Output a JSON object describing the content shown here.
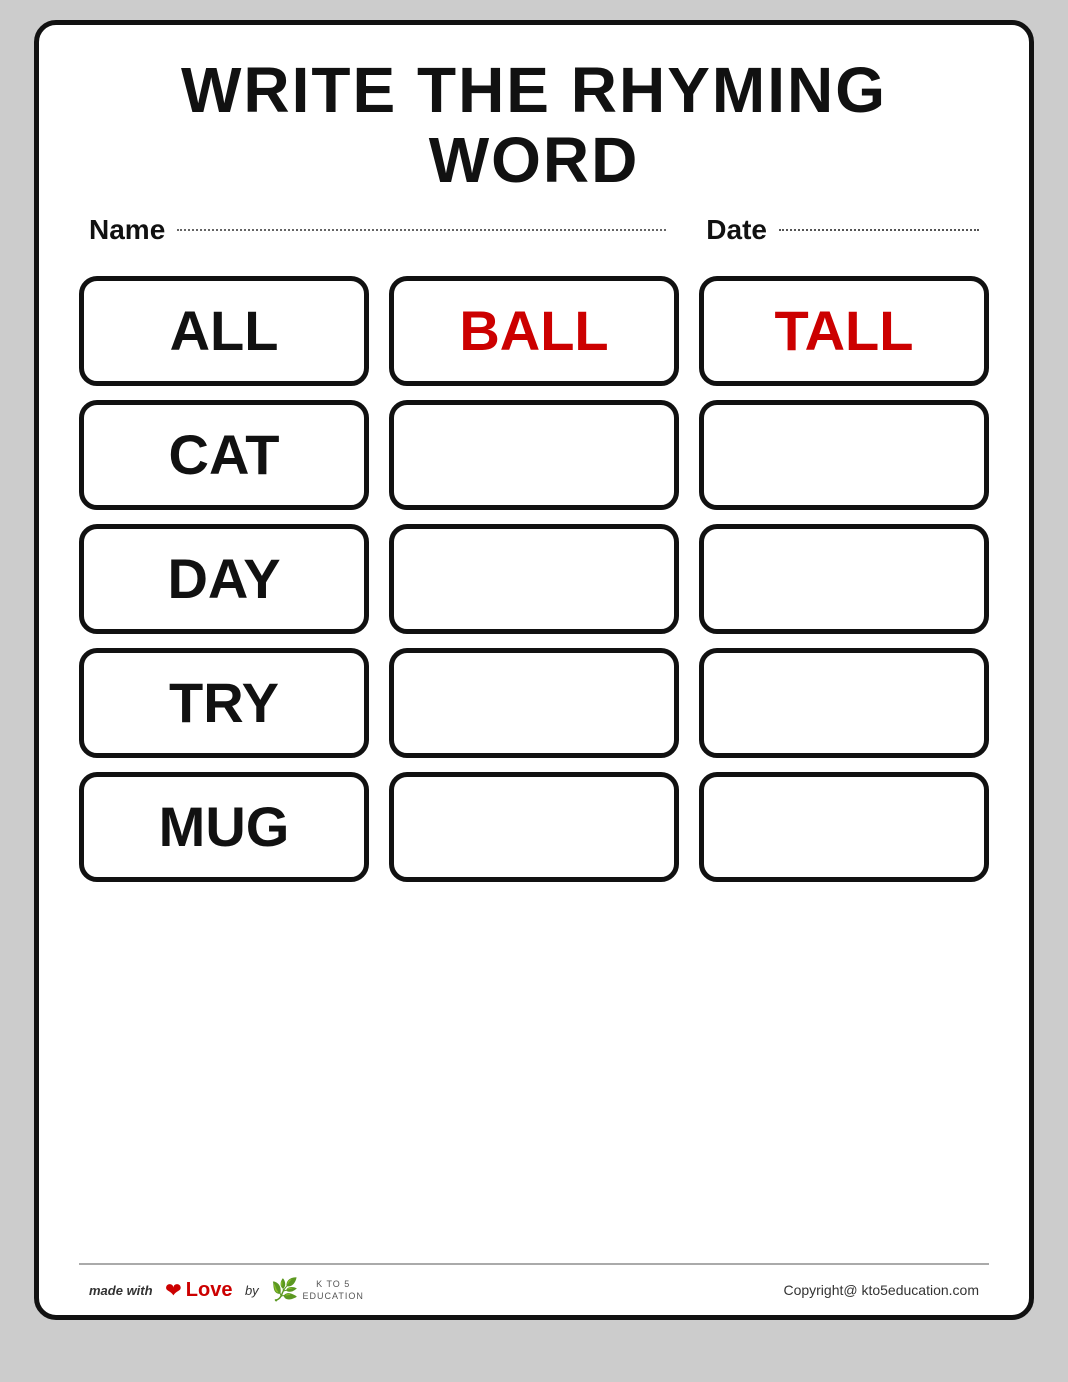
{
  "title": {
    "line1": "WRITE THE RHYMING",
    "line2": "WORD"
  },
  "fields": {
    "name_label": "Name",
    "date_label": "Date"
  },
  "rows": [
    {
      "col1": {
        "text": "ALL",
        "color": "black",
        "empty": false
      },
      "col2": {
        "text": "BALL",
        "color": "red",
        "empty": false
      },
      "col3": {
        "text": "TALL",
        "color": "red",
        "empty": false
      }
    },
    {
      "col1": {
        "text": "CAT",
        "color": "black",
        "empty": false
      },
      "col2": {
        "text": "",
        "color": "black",
        "empty": true
      },
      "col3": {
        "text": "",
        "color": "black",
        "empty": true
      }
    },
    {
      "col1": {
        "text": "DAY",
        "color": "black",
        "empty": false
      },
      "col2": {
        "text": "",
        "color": "black",
        "empty": true
      },
      "col3": {
        "text": "",
        "color": "black",
        "empty": true
      }
    },
    {
      "col1": {
        "text": "TRY",
        "color": "black",
        "empty": false
      },
      "col2": {
        "text": "",
        "color": "black",
        "empty": true
      },
      "col3": {
        "text": "",
        "color": "black",
        "empty": true
      }
    },
    {
      "col1": {
        "text": "MUG",
        "color": "black",
        "empty": false
      },
      "col2": {
        "text": "",
        "color": "black",
        "empty": true
      },
      "col3": {
        "text": "",
        "color": "black",
        "empty": true
      }
    }
  ],
  "footer": {
    "made_with": "made with",
    "love": "Love",
    "by": "by",
    "copyright": "Copyright@ kto5education.com"
  }
}
